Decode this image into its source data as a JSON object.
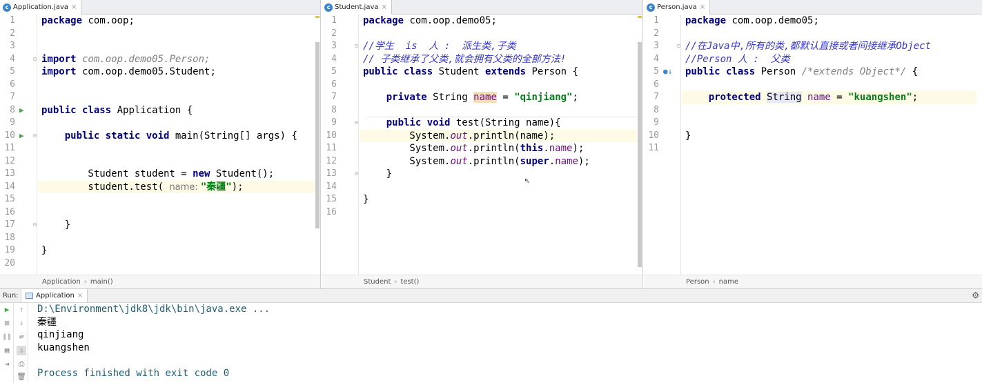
{
  "panes": [
    {
      "tab": {
        "icon": "c",
        "label": "Application.java",
        "close": "×"
      },
      "breadcrumb": [
        "Application",
        "main()"
      ],
      "lines": [
        {
          "n": "1",
          "t": [
            {
              "c": "kw",
              "v": "package"
            },
            {
              "v": " com.oop;"
            }
          ]
        },
        {
          "n": "2",
          "t": []
        },
        {
          "n": "3",
          "t": []
        },
        {
          "n": "4",
          "t": [
            {
              "c": "kw",
              "v": "import"
            },
            {
              "c": "cmt",
              "v": " com.oop.demo05.Person;"
            }
          ]
        },
        {
          "n": "5",
          "t": [
            {
              "c": "kw",
              "v": "import"
            },
            {
              "v": " com.oop.demo05.Student;"
            }
          ]
        },
        {
          "n": "6",
          "t": []
        },
        {
          "n": "7",
          "t": []
        },
        {
          "n": "8",
          "t": [
            {
              "c": "kw",
              "v": "public class"
            },
            {
              "v": " Application {"
            }
          ]
        },
        {
          "n": "9",
          "t": []
        },
        {
          "n": "10",
          "t": [
            {
              "v": "    "
            },
            {
              "c": "kw",
              "v": "public static void"
            },
            {
              "v": " main(String[] args) {"
            }
          ]
        },
        {
          "n": "11",
          "t": []
        },
        {
          "n": "12",
          "t": []
        },
        {
          "n": "13",
          "t": [
            {
              "v": "        Student student = "
            },
            {
              "c": "kw",
              "v": "new"
            },
            {
              "v": " Student();"
            }
          ]
        },
        {
          "n": "14",
          "t": [
            {
              "v": "        student.test( "
            },
            {
              "c": "hint",
              "v": "name: "
            },
            {
              "c": "str",
              "v": "\"秦疆\""
            },
            {
              "v": ");"
            }
          ]
        },
        {
          "n": "15",
          "t": []
        },
        {
          "n": "16",
          "t": []
        },
        {
          "n": "17",
          "t": [
            {
              "v": "    }"
            }
          ]
        },
        {
          "n": "18",
          "t": []
        },
        {
          "n": "19",
          "t": [
            {
              "v": "}"
            }
          ]
        },
        {
          "n": "20",
          "t": []
        }
      ]
    },
    {
      "tab": {
        "icon": "c",
        "label": "Student.java",
        "close": "×"
      },
      "breadcrumb": [
        "Student",
        "test()"
      ],
      "lines": [
        {
          "n": "1",
          "t": [
            {
              "c": "kw",
              "v": "package"
            },
            {
              "v": " com.oop.demo05;"
            }
          ]
        },
        {
          "n": "2",
          "t": []
        },
        {
          "n": "3",
          "t": [
            {
              "c": "doc",
              "v": "//学生  is  人 :  派生类,子类"
            }
          ]
        },
        {
          "n": "4",
          "t": [
            {
              "c": "doc",
              "v": "// 子类继承了父类,就会拥有父类的全部方法!"
            }
          ]
        },
        {
          "n": "5",
          "t": [
            {
              "c": "kw",
              "v": "public class"
            },
            {
              "v": " Student "
            },
            {
              "c": "kw",
              "v": "extends"
            },
            {
              "v": " Person {"
            }
          ]
        },
        {
          "n": "6",
          "t": []
        },
        {
          "n": "7",
          "t": [
            {
              "v": "    "
            },
            {
              "c": "kw",
              "v": "private"
            },
            {
              "v": " String "
            },
            {
              "c": "field hl-name",
              "v": "name"
            },
            {
              "v": " = "
            },
            {
              "c": "str",
              "v": "\"qinjiang\""
            },
            {
              "v": ";"
            }
          ]
        },
        {
          "n": "8",
          "t": []
        },
        {
          "n": "9",
          "t": [
            {
              "v": "    "
            },
            {
              "c": "kw",
              "v": "public void"
            },
            {
              "v": " test(String name){"
            }
          ]
        },
        {
          "n": "10",
          "t": [
            {
              "v": "        System."
            },
            {
              "c": "static-f",
              "v": "out"
            },
            {
              "v": ".println(name);"
            }
          ]
        },
        {
          "n": "11",
          "t": [
            {
              "v": "        System."
            },
            {
              "c": "static-f",
              "v": "out"
            },
            {
              "v": ".println("
            },
            {
              "c": "kw",
              "v": "this"
            },
            {
              "v": "."
            },
            {
              "c": "field",
              "v": "name"
            },
            {
              "v": ");"
            }
          ]
        },
        {
          "n": "12",
          "t": [
            {
              "v": "        System."
            },
            {
              "c": "static-f",
              "v": "out"
            },
            {
              "v": ".println("
            },
            {
              "c": "kw",
              "v": "super"
            },
            {
              "v": "."
            },
            {
              "c": "field",
              "v": "name"
            },
            {
              "v": ");"
            }
          ]
        },
        {
          "n": "13",
          "t": [
            {
              "v": "    }"
            }
          ]
        },
        {
          "n": "14",
          "t": []
        },
        {
          "n": "15",
          "t": [
            {
              "v": "}"
            }
          ]
        },
        {
          "n": "16",
          "t": []
        }
      ]
    },
    {
      "tab": {
        "icon": "c",
        "label": "Person.java",
        "close": "×"
      },
      "breadcrumb": [
        "Person",
        "name"
      ],
      "lines": [
        {
          "n": "1",
          "t": [
            {
              "c": "kw",
              "v": "package"
            },
            {
              "v": " com.oop.demo05;"
            }
          ]
        },
        {
          "n": "2",
          "t": []
        },
        {
          "n": "3",
          "t": [
            {
              "c": "doc",
              "v": "//在Java中,所有的类,都默认直接或者间接继承Object"
            }
          ]
        },
        {
          "n": "4",
          "t": [
            {
              "c": "doc",
              "v": "//Person 人 :  父类"
            }
          ]
        },
        {
          "n": "5",
          "t": [
            {
              "c": "kw",
              "v": "public class"
            },
            {
              "v": " Person "
            },
            {
              "c": "cmt",
              "v": "/*extends Object*/"
            },
            {
              "v": " {"
            }
          ]
        },
        {
          "n": "6",
          "t": []
        },
        {
          "n": "7",
          "t": [
            {
              "v": "    "
            },
            {
              "c": "kw",
              "v": "protected"
            },
            {
              "v": " "
            },
            {
              "c": "hl-type",
              "v": "String"
            },
            {
              "v": " "
            },
            {
              "c": "field",
              "v": "name"
            },
            {
              "v": " = "
            },
            {
              "c": "str",
              "v": "\"kuangshen\""
            },
            {
              "v": ";"
            }
          ]
        },
        {
          "n": "8",
          "t": []
        },
        {
          "n": "9",
          "t": []
        },
        {
          "n": "10",
          "t": [
            {
              "v": "}"
            }
          ]
        },
        {
          "n": "11",
          "t": []
        }
      ]
    }
  ],
  "run": {
    "label": "Run:",
    "tab": "Application",
    "tab_close": "×",
    "output": [
      {
        "c": "cmd",
        "v": "D:\\Environment\\jdk8\\jdk\\bin\\java.exe ..."
      },
      {
        "c": "",
        "v": "秦疆"
      },
      {
        "c": "",
        "v": "qinjiang"
      },
      {
        "c": "",
        "v": "kuangshen"
      },
      {
        "c": "",
        "v": ""
      },
      {
        "c": "proc",
        "v": "Process finished with exit code 0"
      }
    ]
  },
  "icons": {
    "run_gutter": "run-triangle-icon",
    "fold": "fold-marker-icon",
    "override": "override-indicator-icon",
    "settings": "gear-icon",
    "tools_left": [
      "run-icon",
      "stop-icon",
      "pause-icon",
      "dump-icon",
      "exit-icon"
    ],
    "tools_right": [
      "up-arrow-icon",
      "down-arrow-icon",
      "wrap-icon",
      "scroll-end-icon",
      "print-icon",
      "trash-icon"
    ]
  },
  "colors": {
    "keyword": "#000080",
    "string": "#067d17",
    "field": "#660e7a",
    "comment_doc": "#3535c9",
    "current_line": "#fdfbe6",
    "run_green": "#4aa34a"
  }
}
